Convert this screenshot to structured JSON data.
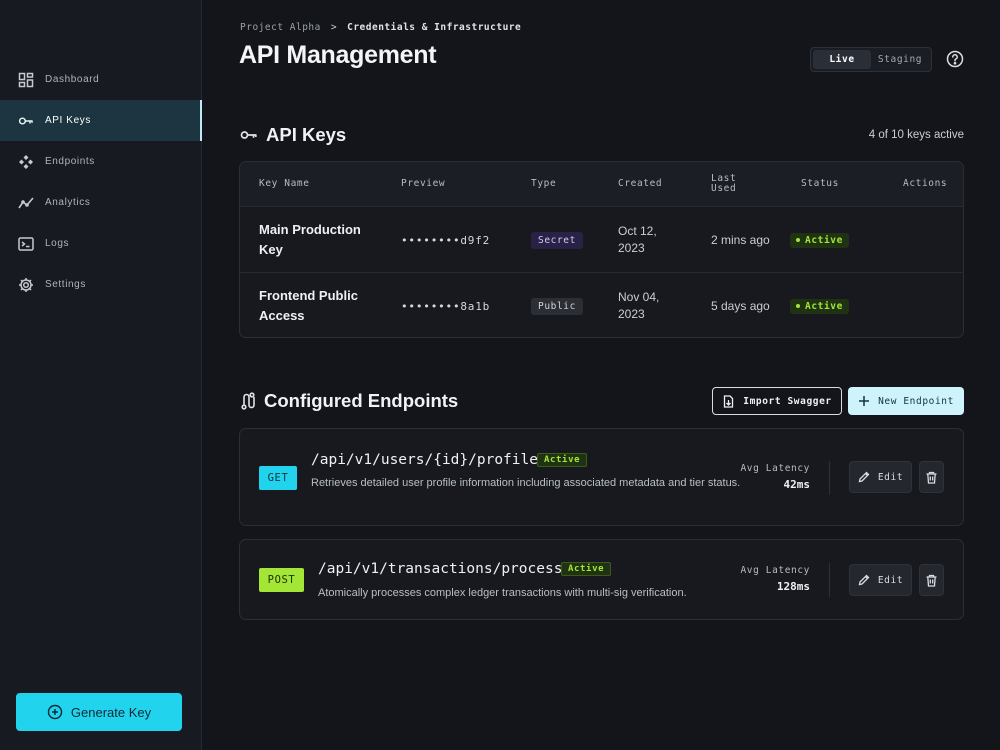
{
  "sidebar": {
    "items": [
      {
        "label": "Dashboard",
        "icon": "dashboard-icon",
        "active": false
      },
      {
        "label": "API Keys",
        "icon": "key-icon",
        "active": true
      },
      {
        "label": "Endpoints",
        "icon": "endpoints-icon",
        "active": false
      },
      {
        "label": "Analytics",
        "icon": "analytics-icon",
        "active": false
      },
      {
        "label": "Logs",
        "icon": "terminal-icon",
        "active": false
      },
      {
        "label": "Settings",
        "icon": "gear-icon",
        "active": false
      }
    ],
    "generate_label": "Generate Key"
  },
  "header": {
    "breadcrumb": [
      "Project Alpha",
      "Credentials & Infrastructure"
    ],
    "breadcrumb_sep": ">",
    "title": "API Management",
    "env_options": [
      "Live",
      "Staging"
    ],
    "env_selected": "Live"
  },
  "api_keys": {
    "title": "API Keys",
    "count_text": "4 of 10 keys active",
    "columns": {
      "key_name": "Key Name",
      "preview": "Preview",
      "type": "Type",
      "created": "Created",
      "last_used_1": "Last",
      "last_used_2": "Used",
      "status": "Status",
      "actions": "Actions"
    },
    "rows": [
      {
        "name": "Main Production Key",
        "preview": "••••••••d9f2",
        "type": "Secret",
        "created": "Oct 12, 2023",
        "last_used": "2 mins ago",
        "status": "Active"
      },
      {
        "name": "Frontend Public Access",
        "preview": "••••••••8a1b",
        "type": "Public",
        "created": "Nov 04, 2023",
        "last_used": "5 days ago",
        "status": "Active"
      }
    ]
  },
  "endpoints": {
    "title": "Configured Endpoints",
    "import_label": "Import Swagger",
    "new_label": "New Endpoint",
    "items": [
      {
        "method": "GET",
        "path": "/api/v1/users/{id}/profile",
        "status": "Active",
        "description": "Retrieves detailed user profile information including associated metadata and tier status.",
        "latency_label": "Avg Latency",
        "latency": "42ms",
        "edit_label": "Edit"
      },
      {
        "method": "POST",
        "path": "/api/v1/transactions/process",
        "status": "Active",
        "description": "Atomically processes complex ledger transactions with multi-sig verification.",
        "latency_label": "Avg Latency",
        "latency": "128ms",
        "edit_label": "Edit"
      }
    ]
  },
  "colors": {
    "accent_cyan": "#22d3ee",
    "accent_green": "#a3e635",
    "background": "#13151a"
  }
}
